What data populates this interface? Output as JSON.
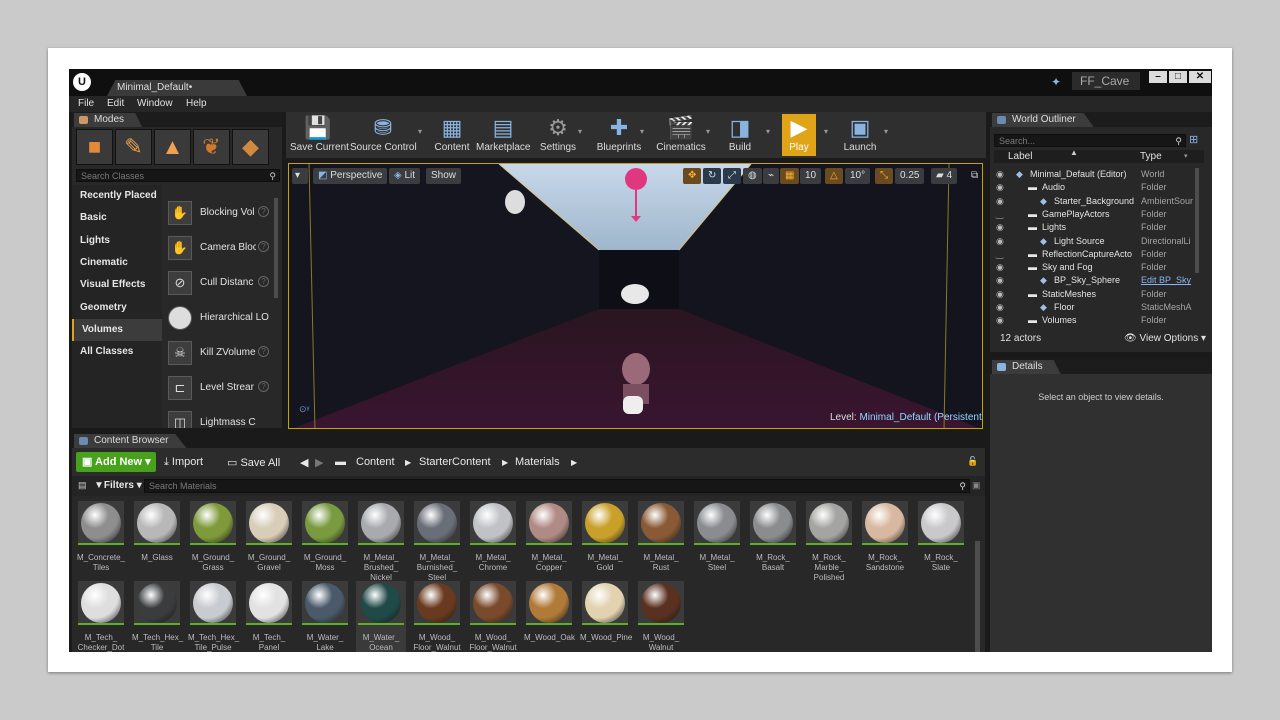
{
  "window": {
    "doc_tab": "Minimal_Default•",
    "project": "FF_Cave"
  },
  "menu": [
    "File",
    "Edit",
    "Window",
    "Help"
  ],
  "modes": {
    "tab": "Modes",
    "search_placeholder": "Search Classes",
    "categories": [
      "Recently Placed",
      "Basic",
      "Lights",
      "Cinematic",
      "Visual Effects",
      "Geometry",
      "Volumes",
      "All Classes"
    ],
    "selected_category": "Volumes",
    "classes": [
      "Blocking Vol",
      "Camera Bloc",
      "Cull Distanc",
      "Hierarchical LO",
      "Kill ZVolume",
      "Level Strear",
      "Lightmass C"
    ]
  },
  "toolbar": [
    "Save Current",
    "Source Control",
    "Content",
    "Marketplace",
    "Settings",
    "Blueprints",
    "Cinematics",
    "Build",
    "Play",
    "Launch"
  ],
  "viewport": {
    "perspective": "Perspective",
    "lit": "Lit",
    "show": "Show",
    "grid": "10",
    "angle": "10°",
    "scale": "0.25",
    "cam_speed": "4",
    "level_label": "Level:",
    "level_name": "Minimal_Default (Persistent)"
  },
  "content_browser": {
    "tab": "Content Browser",
    "add_new": "Add New",
    "import": "Import",
    "save_all": "Save All",
    "crumbs": [
      "Content",
      "StarterContent",
      "Materials"
    ],
    "filters": "Filters",
    "search_placeholder": "Search Materials",
    "assets": [
      {
        "name": "M_Concrete_\nTiles",
        "color": "#8e8e8e"
      },
      {
        "name": "M_Glass",
        "color": "#b8b8b8"
      },
      {
        "name": "M_Ground_\nGrass",
        "color": "#7f9a3a"
      },
      {
        "name": "M_Ground_\nGravel",
        "color": "#d8cdb8"
      },
      {
        "name": "M_Ground_\nMoss",
        "color": "#7a9a40"
      },
      {
        "name": "M_Metal_\nBrushed_\nNickel",
        "color": "#a8aaae"
      },
      {
        "name": "M_Metal_\nBurnished_\nSteel",
        "color": "#6a6e78"
      },
      {
        "name": "M_Metal_\nChrome",
        "color": "#c0c2c6"
      },
      {
        "name": "M_Metal_\nCopper",
        "color": "#b08a84"
      },
      {
        "name": "M_Metal_\nGold",
        "color": "#c9a02a"
      },
      {
        "name": "M_Metal_\nRust",
        "color": "#8a5a36"
      },
      {
        "name": "M_Metal_\nSteel",
        "color": "#8a8c90"
      },
      {
        "name": "M_Rock_\nBasalt",
        "color": "#8a8c8e"
      },
      {
        "name": "M_Rock_\nMarble_\nPolished",
        "color": "#a4a4a2"
      },
      {
        "name": "M_Rock_\nSandstone",
        "color": "#d8b8a0"
      },
      {
        "name": "M_Rock_\nSlate",
        "color": "#c9c9cc"
      },
      {
        "name": "M_Tech_\nChecker_Dot",
        "color": "#dedede"
      },
      {
        "name": "M_Tech_Hex_\nTile",
        "color": "#3a3c3e"
      },
      {
        "name": "M_Tech_Hex_\nTile_Pulse",
        "color": "#c8cbd0"
      },
      {
        "name": "M_Tech_\nPanel",
        "color": "#e2e2e2"
      },
      {
        "name": "M_Water_\nLake",
        "color": "#4a5a6a"
      },
      {
        "name": "M_Water_\nOcean",
        "color": "#204a48"
      },
      {
        "name": "M_Wood_\nFloor_Walnut\n_Polished",
        "color": "#6a3a20"
      },
      {
        "name": "M_Wood_\nFloor_Walnut\n_Worn",
        "color": "#7a4a2c"
      },
      {
        "name": "M_Wood_Oak",
        "color": "#b07a38"
      },
      {
        "name": "M_Wood_Pine",
        "color": "#e2d2b0"
      },
      {
        "name": "M_Wood_\nWalnut",
        "color": "#5a3020"
      }
    ]
  },
  "outliner": {
    "tab": "World Outliner",
    "search_placeholder": "Search...",
    "col_label": "Label",
    "col_type": "Type",
    "rows": [
      {
        "name": "Minimal_Default (Editor)",
        "type": "World",
        "indent": 0
      },
      {
        "name": "Audio",
        "type": "Folder",
        "indent": 1
      },
      {
        "name": "Starter_Background",
        "type": "AmbientSour",
        "indent": 2
      },
      {
        "name": "GamePlayActors",
        "type": "Folder",
        "indent": 1
      },
      {
        "name": "Lights",
        "type": "Folder",
        "indent": 1
      },
      {
        "name": "Light Source",
        "type": "DirectionalLi",
        "indent": 2
      },
      {
        "name": "ReflectionCaptureActo",
        "type": "Folder",
        "indent": 1
      },
      {
        "name": "Sky and Fog",
        "type": "Folder",
        "indent": 1
      },
      {
        "name": "BP_Sky_Sphere",
        "type": "Edit BP_Sky",
        "indent": 2
      },
      {
        "name": "StaticMeshes",
        "type": "Folder",
        "indent": 1
      },
      {
        "name": "Floor",
        "type": "StaticMeshA",
        "indent": 2
      },
      {
        "name": "Volumes",
        "type": "Folder",
        "indent": 1
      }
    ],
    "actor_count": "12 actors",
    "view_options": "View Options"
  },
  "details": {
    "tab": "Details",
    "empty": "Select an object to view details."
  }
}
